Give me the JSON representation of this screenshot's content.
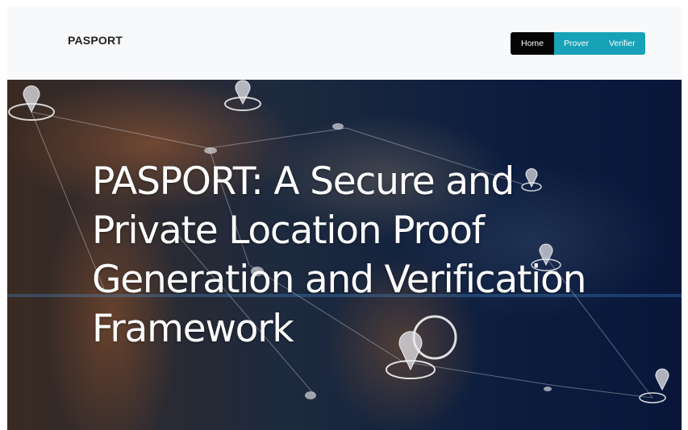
{
  "navbar": {
    "brand": "PASPORT",
    "links": [
      {
        "label": "Home",
        "active": true
      },
      {
        "label": "Prover",
        "active": false
      },
      {
        "label": "Verifier",
        "active": false
      }
    ]
  },
  "hero": {
    "title": "PASPORT: A Secure and Private Location Proof Generation and Verification Framework"
  },
  "colors": {
    "navbar_bg": "#f8f9fa",
    "nav_active": "#050505",
    "nav_accent": "#17a2b8",
    "hero_dark": "#08163a"
  },
  "icons": [
    "location-pin-icon"
  ]
}
